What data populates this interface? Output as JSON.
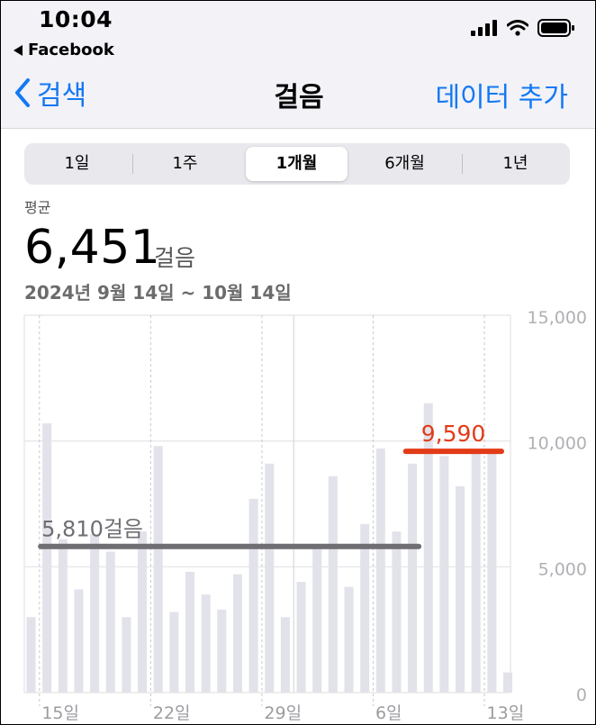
{
  "status_bar": {
    "time": "10:04",
    "back_app": "Facebook"
  },
  "nav": {
    "back_label": "검색",
    "title": "걸음",
    "add_label": "데이터 추가"
  },
  "segments": [
    "1일",
    "1주",
    "1개월",
    "6개월",
    "1년"
  ],
  "selected_segment": "1개월",
  "summary": {
    "label": "평균",
    "value": "6,451",
    "unit": "걸음",
    "date_range": "2024년 9월 14일 ~ 10월 14일"
  },
  "annotations": {
    "gray_line_label": "5,810걸음",
    "red_line_label": "9,590"
  },
  "colors": {
    "accent": "#1378f4",
    "bar": "#e2e2ea",
    "gray_line": "#6e6e73",
    "red_line": "#e23b18"
  },
  "chart_data": {
    "type": "bar",
    "dates": [
      "2024-09-14",
      "2024-09-15",
      "2024-09-16",
      "2024-09-17",
      "2024-09-18",
      "2024-09-19",
      "2024-09-20",
      "2024-09-21",
      "2024-09-22",
      "2024-09-23",
      "2024-09-24",
      "2024-09-25",
      "2024-09-26",
      "2024-09-27",
      "2024-09-28",
      "2024-09-29",
      "2024-09-30",
      "2024-10-01",
      "2024-10-02",
      "2024-10-03",
      "2024-10-04",
      "2024-10-05",
      "2024-10-06",
      "2024-10-07",
      "2024-10-08",
      "2024-10-09",
      "2024-10-10",
      "2024-10-11",
      "2024-10-12",
      "2024-10-13",
      "2024-10-14"
    ],
    "values": [
      3000,
      10700,
      6100,
      4100,
      6300,
      5600,
      3000,
      6400,
      9800,
      3200,
      4800,
      3900,
      3300,
      4700,
      7700,
      9100,
      3000,
      4400,
      5800,
      8600,
      4200,
      6700,
      9700,
      6400,
      9100,
      11500,
      9400,
      8200,
      9500,
      9600,
      800
    ],
    "x_tick_labels": [
      "15일",
      "22일",
      "29일",
      "6일",
      "13일"
    ],
    "y_tick_labels": [
      "15,000",
      "10,000",
      "5,000",
      "0"
    ],
    "ylim": [
      0,
      15000
    ],
    "reference_lines": [
      {
        "value": 5810,
        "from_date": "2024-09-15",
        "to_date": "2024-10-08",
        "label": "5,810걸음"
      },
      {
        "value": 9590,
        "from_date": "2024-10-09",
        "to_date": "2024-10-14",
        "label": "9,590"
      }
    ]
  }
}
